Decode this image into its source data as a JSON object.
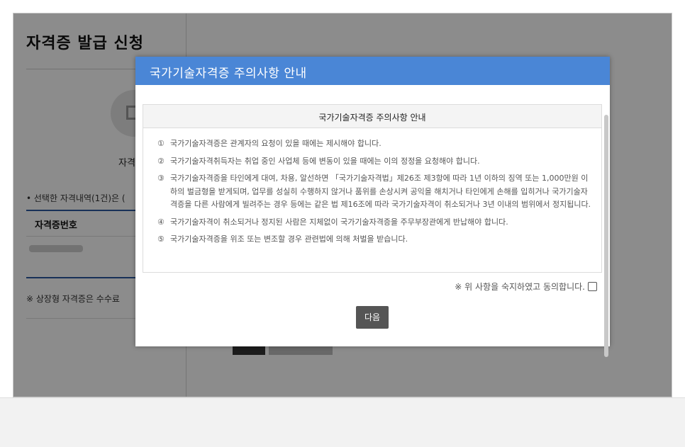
{
  "page": {
    "title": "자격증 발급 신청",
    "step_label": "자격",
    "selected_text": "• 선택한 자격내역(1건)은 (",
    "col_header": "자격증번호",
    "note": "※ 상장형 자격증은 수수료"
  },
  "modal": {
    "title": "국가기술자격증 주의사항 안내",
    "box_title": "국가기술자격증 주의사항 안내",
    "items": [
      {
        "num": "①",
        "text": "국가기술자격증은 관계자의 요청이 있을 때에는 제시해야 합니다."
      },
      {
        "num": "②",
        "text": "국가기술자격취득자는 취업 중인 사업체 등에 변동이 있을 때에는 이의 정정을 요청해야 합니다."
      },
      {
        "num": "③",
        "text": "국가기술자격증을 타인에게 대여, 차용, 알선하면 「국가기술자격법」제26조 제3항에 따라 1년 이하의 징역 또는 1,000만원 이하의 벌금형을 받게되며, 업무를 성실히 수행하지 않거나 품위를 손상시켜 공익을 해치거나 타인에게 손해를 입히거나 국가기술자격증을 다른 사람에게 빌려주는 경우 등에는 같은 법 제16조에 따라 국가기술자격이 취소되거나 3년 이내의 범위에서 정지됩니다."
      },
      {
        "num": "④",
        "text": "국가기술자격이 취소되거나 정지된 사람은 지체없이 국가기술자격증을 주무부장관에게 반납해야 합니다."
      },
      {
        "num": "⑤",
        "text": "국가기술자격증을 위조 또는 변조할 경우 관련법에 의해 처벌을 받습니다."
      }
    ],
    "agree_label": "※ 위 사항을 숙지하였고 동의합니다.",
    "agree_checked": false,
    "next_label": "다음"
  },
  "colors": {
    "modal_header": "#4a86d6",
    "next_button": "#555555",
    "accent_rule": "#2c5aa0"
  }
}
